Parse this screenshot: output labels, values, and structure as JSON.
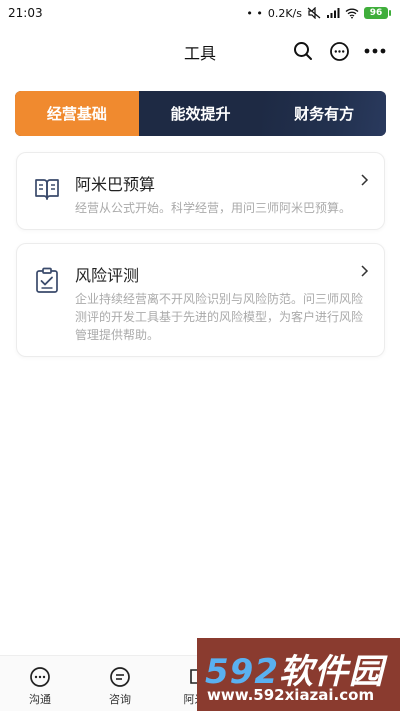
{
  "status_bar": {
    "time": "21:03",
    "network_speed": "0.2K/s",
    "battery": "96"
  },
  "nav": {
    "title": "工具"
  },
  "tabs": [
    {
      "label": "经营基础",
      "active": true
    },
    {
      "label": "能效提升",
      "active": false
    },
    {
      "label": "财务有方",
      "active": false
    }
  ],
  "cards": [
    {
      "title": "阿米巴预算",
      "description": "经营从公式开始。科学经营，用问三师阿米巴预算。",
      "icon": "book-icon"
    },
    {
      "title": "风险评测",
      "description": "企业持续经营离不开风险识别与风险防范。问三师风险测评的开发工具基于先进的风险模型，为客户进行风险管理提供帮助。",
      "icon": "clipboard-check-icon"
    }
  ],
  "bottom_nav": [
    {
      "label": "沟通",
      "icon": "chat-bubble-icon"
    },
    {
      "label": "咨询",
      "icon": "message-icon"
    },
    {
      "label": "阿米巴",
      "icon": "book-icon"
    },
    {
      "label": "",
      "icon": "tools-icon"
    },
    {
      "label": "",
      "icon": "user-icon"
    }
  ],
  "watermark": {
    "brand_num": "592",
    "brand_text": "软件园",
    "url": "www.592xiazai.com"
  },
  "colors": {
    "accent": "#f08a2f",
    "tab_dark": "#1e2a44",
    "muted_text": "#aaaaaa"
  }
}
